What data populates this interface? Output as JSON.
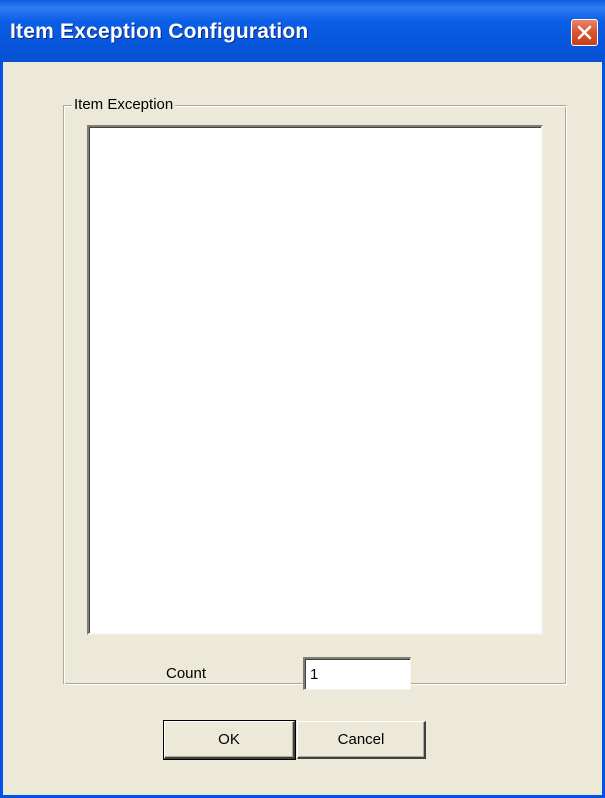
{
  "window": {
    "title": "Item Exception Configuration"
  },
  "titlebar": {
    "close_icon": "close-icon"
  },
  "groupbox": {
    "label": "Item Exception",
    "list_items": []
  },
  "count": {
    "label": "Count",
    "value": "1"
  },
  "buttons": {
    "ok_label": "OK",
    "cancel_label": "Cancel"
  },
  "colors": {
    "titlebar": "#0a5ee5",
    "dialog_background": "#ece9d8",
    "close_button": "#d9532c"
  }
}
